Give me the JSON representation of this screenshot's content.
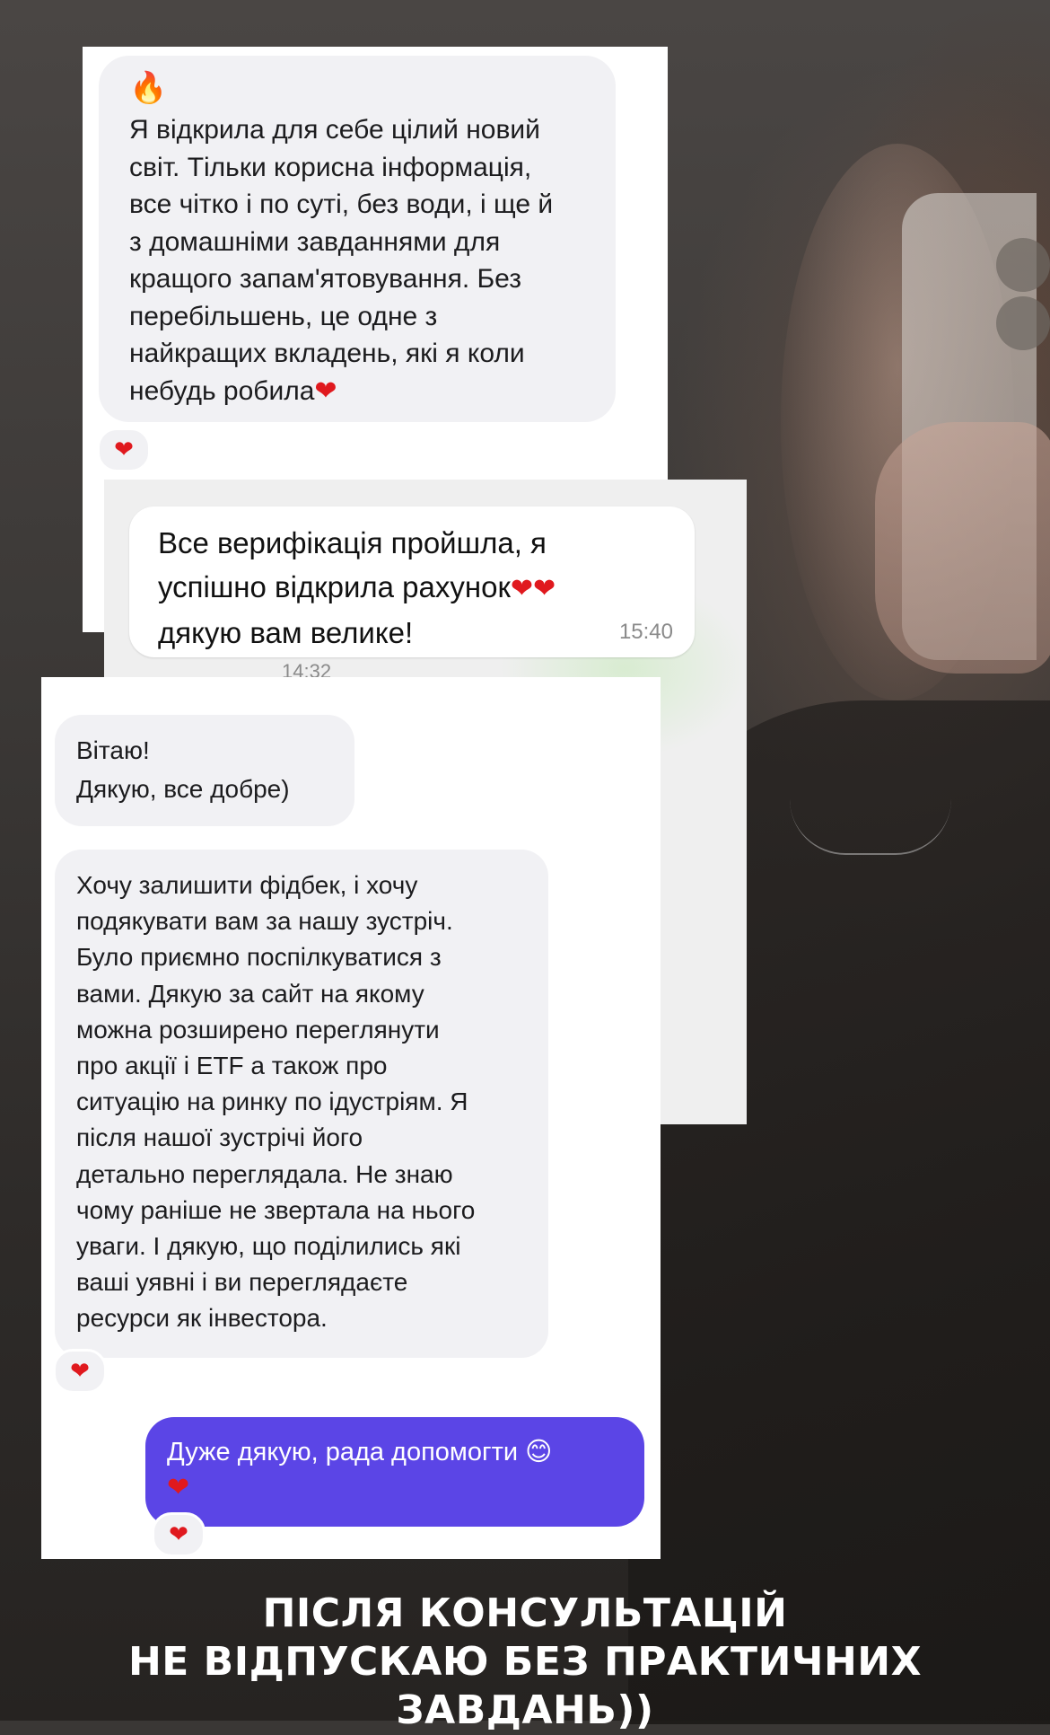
{
  "card1": {
    "emoji": "🔥",
    "message": "Я відкрила для себе цілий новий\nсвіт. Тільки корисна інформація,\nвсе чітко і по суті, без води, і ще й\nз домашніми завданнями для\nкращого запам'ятовування. Без\nперебільшень, це одне з\nнайкращих вкладень, які я коли\nнебудь робила",
    "message_end_emoji": "❤",
    "reaction": "❤"
  },
  "card2": {
    "message": "Все верифікація пройшла, я\nуспішно відкрила рахунок",
    "inline_emoji": "❤❤",
    "message_line3": "дякую вам велике!",
    "time": "15:40",
    "partial_time": "14:32"
  },
  "card3": {
    "message1": "Вітаю!\nДякую, все добре)",
    "message2": "Хочу залишити фідбек, і хочу\nподякувати вам за нашу зустріч.\nБуло приємно поспілкуватися з\nвами. Дякую за сайт на якому\nможна розширено переглянути\nпро акції і ETF а також про\nситуацію на ринку по ідустріям. Я\nпісля нашої зустрічі його\nдетально переглядала. Не знаю\nчому раніше не звертала на нього\nуваги. І дякую, що поділились які\nваші уявні і ви переглядаєте\nресурси як інвестора.",
    "message2_reaction": "❤",
    "reply": "Дуже дякую, рада допомогти 😊",
    "reply_emoji": "❤",
    "reply_reaction": "❤"
  },
  "caption": {
    "line1": "ПІСЛЯ КОНСУЛЬТАЦІЙ",
    "line2": "НЕ ВІДПУСКАЮ БЕЗ ПРАКТИЧНИХ ЗАВДАНЬ))"
  },
  "colors": {
    "accent_bubble": "#5b45e6",
    "heart": "#e0191e",
    "incoming_bubble": "#f1f1f4"
  }
}
